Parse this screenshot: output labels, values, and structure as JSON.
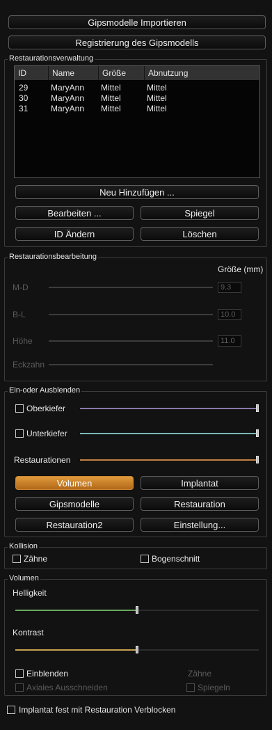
{
  "top": {
    "import_label": "Gipsmodelle Importieren",
    "register_label": "Registrierung des Gipsmodells"
  },
  "restoration_mgmt": {
    "title": "Restaurationsverwaltung",
    "columns": [
      "ID",
      "Name",
      "Größe",
      "Abnutzung"
    ],
    "rows": [
      [
        "29",
        "MaryAnn",
        "Mittel",
        "Mittel"
      ],
      [
        "30",
        "MaryAnn",
        "Mittel",
        "Mittel"
      ],
      [
        "31",
        "MaryAnn",
        "Mittel",
        "Mittel"
      ]
    ],
    "add_label": "Neu Hinzufügen ...",
    "edit_label": "Bearbeiten ...",
    "mirror_label": "Spiegel",
    "change_id_label": "ID Ändern",
    "delete_label": "Löschen"
  },
  "restoration_edit": {
    "title": "Restaurationsbearbeitung",
    "size_header": "Größe (mm)",
    "rows": [
      {
        "label": "M-D",
        "value": "9.3"
      },
      {
        "label": "B-L",
        "value": "10.0"
      },
      {
        "label": "Höhe",
        "value": "11.0"
      },
      {
        "label": "Eckzahn",
        "value": ""
      }
    ]
  },
  "visibility": {
    "title": "Ein-oder Ausblenden",
    "upper_label": "Oberkiefer",
    "upper_color": "#8878a8",
    "lower_label": "Unterkiefer",
    "lower_color": "#7ab8b8",
    "restorations_label": "Restaurationen",
    "restorations_color": "#c08040",
    "buttons": {
      "volume": "Volumen",
      "implant": "Implantat",
      "models": "Gipsmodelle",
      "restoration": "Restauration",
      "restoration2": "Restauration2",
      "settings": "Einstellung..."
    },
    "active_color": "#d88a30"
  },
  "collision": {
    "title": "Kollision",
    "teeth_label": "Zähne",
    "arch_label": "Bogenschnitt"
  },
  "volume": {
    "title": "Volumen",
    "brightness_label": "Helligkeit",
    "brightness_color": "#6aa860",
    "brightness_value": 0.5,
    "contrast_label": "Kontrast",
    "contrast_color": "#c8a050",
    "contrast_value": 0.5,
    "show_label": "Einblenden",
    "teeth_label": "Zähne",
    "axial_cut_label": "Axiales Ausschneiden",
    "mirror_label": "Spiegeln"
  },
  "footer": {
    "lock_label": "Implantat fest mit Restauration Verblocken"
  }
}
